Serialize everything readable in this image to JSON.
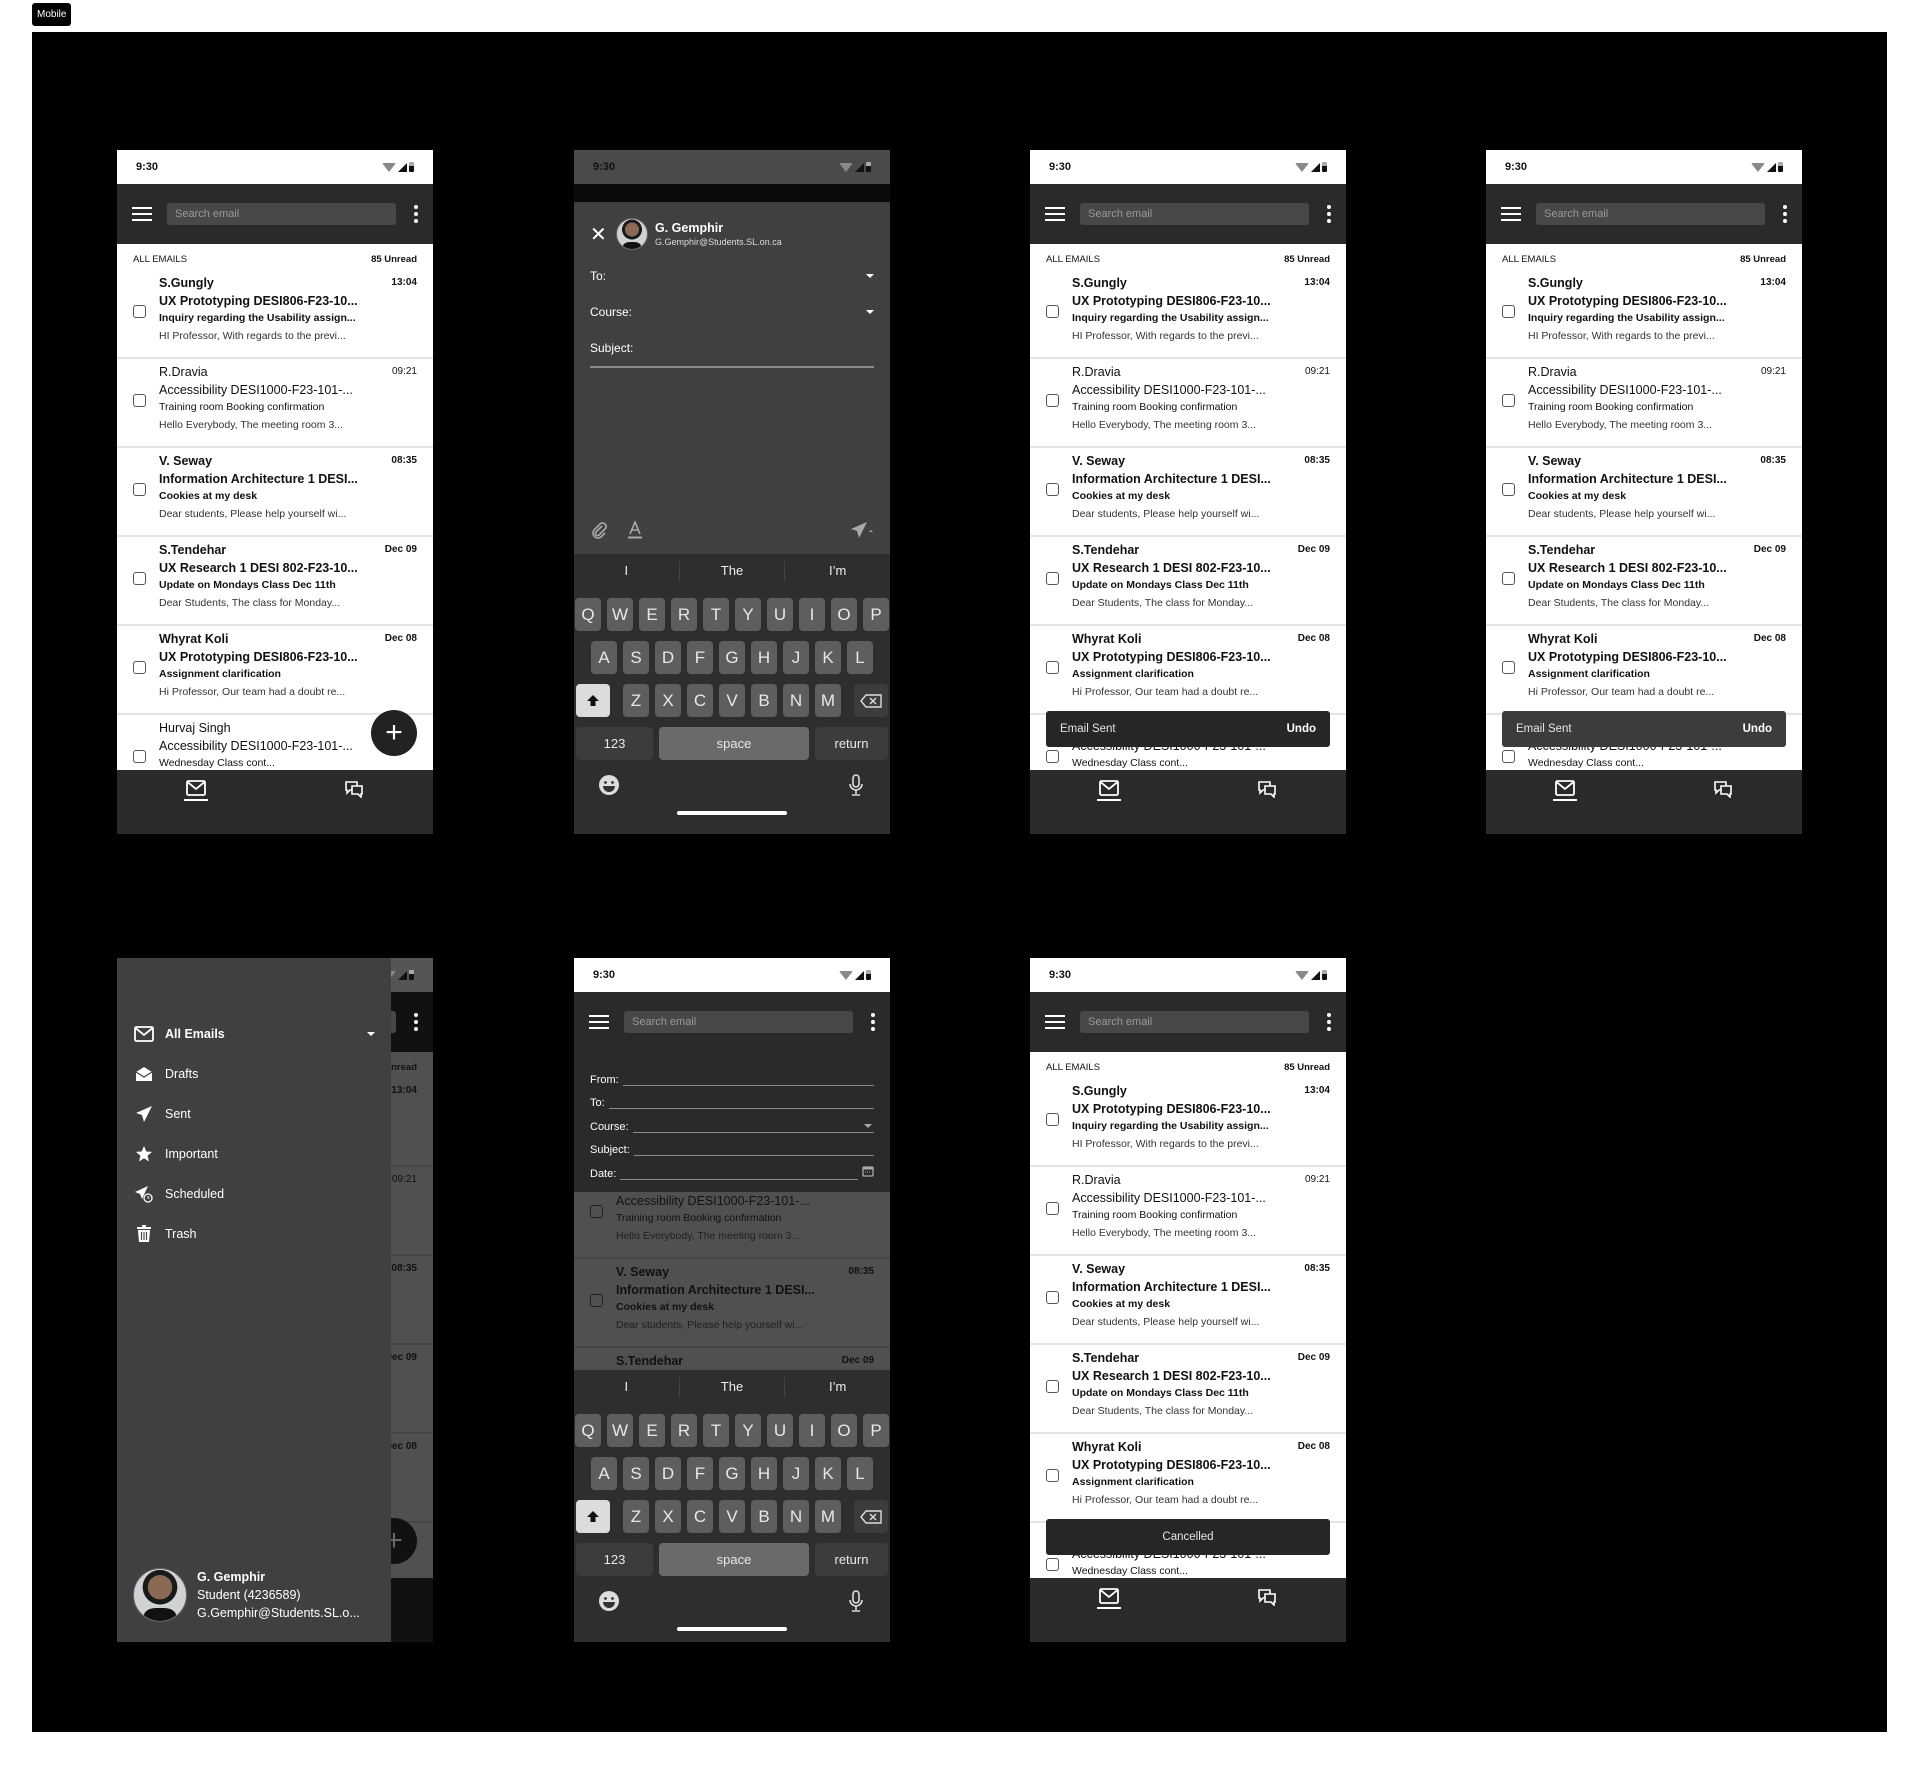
{
  "frame_label": "Mobile",
  "status_time": "9:30",
  "search_placeholder": "Search email",
  "list_header": {
    "title": "ALL EMAILS",
    "unread": "85 Unread"
  },
  "emails": [
    {
      "sender": "S.Gungly",
      "time": "13:04",
      "course": "UX Prototyping DESI806-F23-10...",
      "subject": "Inquiry regarding the Usability assign...",
      "preview": "HI Professor, With regards to the previ...",
      "unread": true
    },
    {
      "sender": "R.Dravia",
      "time": "09:21",
      "course": "Accessibility DESI1000-F23-101-...",
      "subject": "Training room Booking confirmation",
      "preview": "Hello Everybody, The meeting room 3...",
      "unread": false
    },
    {
      "sender": "V. Seway",
      "time": "08:35",
      "course": "Information Architecture 1 DESI...",
      "subject": "Cookies at my desk",
      "preview": "Dear students, Please help yourself wi...",
      "unread": true
    },
    {
      "sender": "S.Tendehar",
      "time": "Dec 09",
      "course": "UX Research 1 DESI 802-F23-10...",
      "subject": "Update on Mondays Class Dec 11th",
      "preview": "Dear Students, The class for Monday...",
      "unread": true
    },
    {
      "sender": "Whyrat Koli",
      "time": "Dec 08",
      "course": "UX Prototyping DESI806-F23-10...",
      "subject": "Assignment clarification",
      "preview": "Hi Professor, Our team had a doubt re...",
      "unread": true
    },
    {
      "sender": "Hurvaj Singh",
      "time": "",
      "course": "Accessibility DESI1000-F23-101-...",
      "subject": "Wednesday Class cont...",
      "preview": "",
      "unread": false
    }
  ],
  "fab_label": "+",
  "snackbars": {
    "sent": {
      "message": "Email Sent",
      "action": "Undo"
    },
    "cancelled": {
      "message": "Cancelled"
    }
  },
  "compose": {
    "close_icon": "close-icon",
    "sender_name": "G. Gemphir",
    "sender_email": "G.Gemphir@Students.SL.on.ca",
    "to_label": "To:",
    "course_label": "Course:",
    "subject_label": "Subject:"
  },
  "keyboard": {
    "suggestions": [
      "I",
      "The",
      "I’m"
    ],
    "row1": [
      "Q",
      "W",
      "E",
      "R",
      "T",
      "Y",
      "U",
      "I",
      "O",
      "P"
    ],
    "row2": [
      "A",
      "S",
      "D",
      "F",
      "G",
      "H",
      "J",
      "K",
      "L"
    ],
    "row3": [
      "Z",
      "X",
      "C",
      "V",
      "B",
      "N",
      "M"
    ],
    "numbers": "123",
    "space": "space",
    "return": "return"
  },
  "filter": {
    "from_label": "From:",
    "to_label": "To:",
    "course_label": "Course:",
    "subject_label": "Subject:",
    "date_label": "Date:"
  },
  "drawer": {
    "items": [
      {
        "label": "All Emails",
        "icon": "mail-icon",
        "active": true
      },
      {
        "label": "Drafts",
        "icon": "drafts-icon"
      },
      {
        "label": "Sent",
        "icon": "send-icon"
      },
      {
        "label": "Important",
        "icon": "star-icon"
      },
      {
        "label": "Scheduled",
        "icon": "scheduled-icon"
      },
      {
        "label": "Trash",
        "icon": "trash-icon"
      }
    ],
    "profile": {
      "name": "G. Gemphir",
      "role": "Student (4236589)",
      "email": "G.Gemphir@Students.SL.o..."
    }
  },
  "drawer_backdrop": {
    "unread_partial": "nread",
    "times": [
      "13:04",
      "09:21",
      "08:35",
      "ec 09",
      "ec 08"
    ]
  }
}
